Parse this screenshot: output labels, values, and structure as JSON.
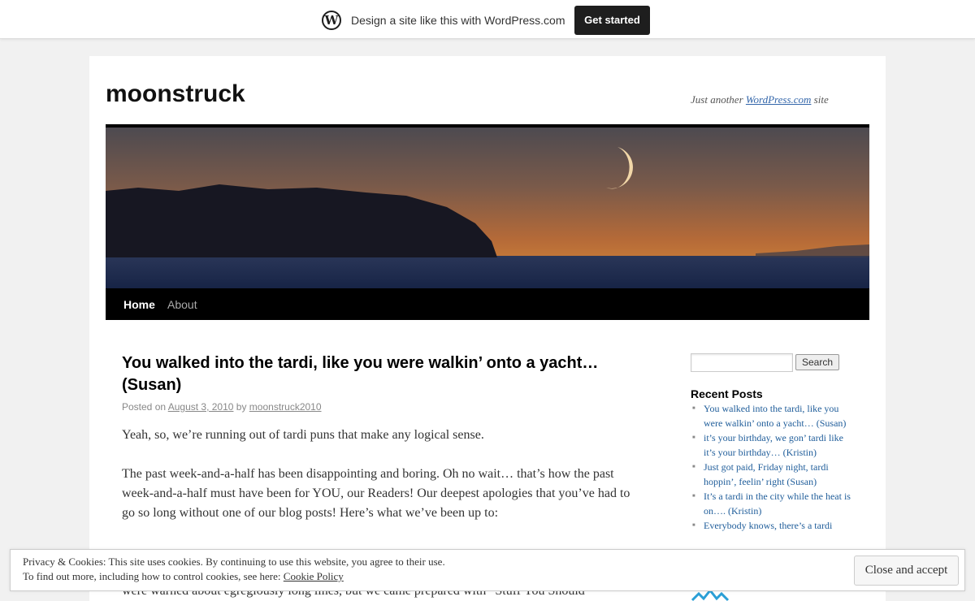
{
  "banner": {
    "logo_icon": "wordpress-logo-icon",
    "logo_glyph": "W",
    "message": "Design a site like this with WordPress.com",
    "cta": "Get started"
  },
  "site": {
    "title": "moonstruck",
    "tagline_prefix": "Just another ",
    "tagline_link": "WordPress.com",
    "tagline_suffix": " site"
  },
  "nav": {
    "items": [
      "Home",
      "About"
    ]
  },
  "post": {
    "title": "You walked into the tardi, like you were walkin’ onto a yacht… (Susan)",
    "posted_on": "Posted on ",
    "date": "August 3, 2010",
    "by": " by ",
    "author": "moonstruck2010",
    "paragraphs": [
      "Yeah, so, we’re running out of tardi puns that make any logical sense.",
      "The past week-and-a-half has been disappointing and boring. Oh no wait… that’s how the past week-and-a-half must have been for YOU, our Readers! Our deepest apologies that you’ve had to go so long without one of our blog posts! Here’s what we’ve been up to:",
      "were warned about egregiously long lines, but we came prepared with “Stuff You Should"
    ]
  },
  "sidebar": {
    "search_button": "Search",
    "search_placeholder": "",
    "recent_posts_title": "Recent Posts",
    "recent_posts": [
      "You walked into the tardi, like you were walkin’ onto a yacht… (Susan)",
      "it’s your birthday, we gon’ tardi like it’s your birthday… (Kristin)",
      "Just got paid, Friday night, tardi hoppin’, feelin’ right (Susan)",
      "It’s a tardi in the city while the heat is on…. (Kristin)",
      "Everybody knows, there’s a tardi"
    ]
  },
  "cookie": {
    "line1": "Privacy & Cookies: This site uses cookies. By continuing to use this website, you agree to their use.",
    "line2_prefix": "To find out more, including how to control cookies, see here: ",
    "line2_link": "Cookie Policy",
    "accept": "Close and accept"
  },
  "colors": {
    "link": "#1f5d9a",
    "nav_bg": "#000000",
    "sky_top": "#4a4a52",
    "sky_horizon": "#b86a3a",
    "water": "#1c2a4a"
  }
}
